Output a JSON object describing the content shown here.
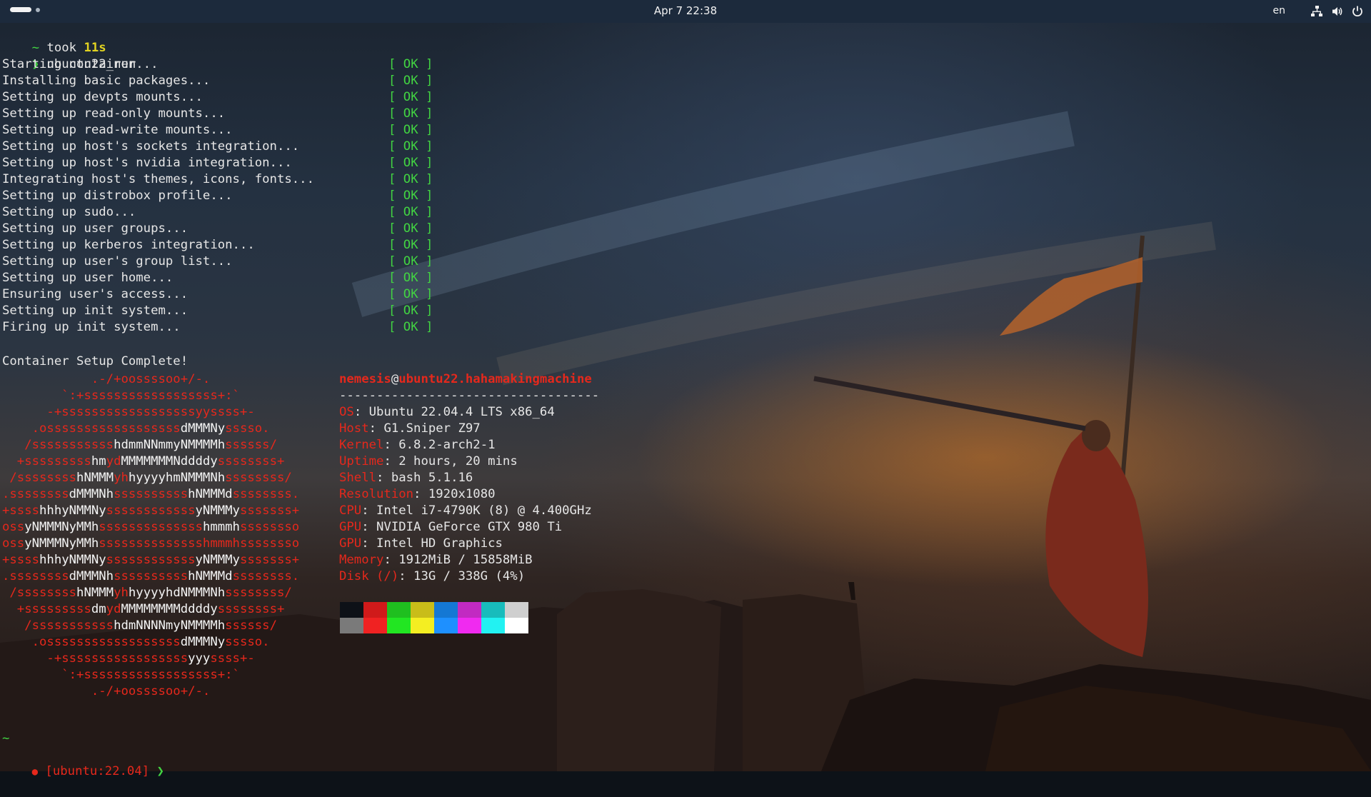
{
  "topbar": {
    "clock": "Apr 7  22:38",
    "language": "en"
  },
  "terminal": {
    "prev_prompt": {
      "tilde": "~",
      "took": "took",
      "duration": "11s"
    },
    "command": {
      "arrow": "❯",
      "text": "ubuntu22_run"
    },
    "setup_steps": [
      "Starting container...",
      "Installing basic packages...",
      "Setting up devpts mounts...",
      "Setting up read-only mounts...",
      "Setting up read-write mounts...",
      "Setting up host's sockets integration...",
      "Setting up host's nvidia integration...",
      "Integrating host's themes, icons, fonts...",
      "Setting up distrobox profile...",
      "Setting up sudo...",
      "Setting up user groups...",
      "Setting up kerberos integration...",
      "Setting up user's group list...",
      "Setting up user home...",
      "Ensuring user's access...",
      "Setting up init system...",
      "Firing up init system..."
    ],
    "ok_label": "[ OK ]",
    "complete_message": "Container Setup Complete!",
    "logo_lines": [
      [
        [
          "r",
          "            .-/+oossssoo+/-."
        ]
      ],
      [
        [
          "r",
          "        `:+ssssssssssssssssss+:`"
        ]
      ],
      [
        [
          "r",
          "      -+ssssssssssssssssssyyssss+-"
        ]
      ],
      [
        [
          "r",
          "    .ossssssssssssssssss"
        ],
        [
          "w",
          "dMMMNy"
        ],
        [
          "r",
          "sssso."
        ]
      ],
      [
        [
          "r",
          "   /sssssssssss"
        ],
        [
          "w",
          "hdmmNNmmyNMMMMh"
        ],
        [
          "r",
          "ssssss/"
        ]
      ],
      [
        [
          "r",
          "  +sssssssss"
        ],
        [
          "w",
          "hm"
        ],
        [
          "r",
          "yd"
        ],
        [
          "w",
          "MMMMMMMNddddy"
        ],
        [
          "r",
          "ssssssss+"
        ]
      ],
      [
        [
          "r",
          " /ssssssss"
        ],
        [
          "w",
          "hNMMM"
        ],
        [
          "r",
          "yh"
        ],
        [
          "w",
          "hyyyyhmNMMMNh"
        ],
        [
          "r",
          "ssssssss/"
        ]
      ],
      [
        [
          "r",
          ".ssssssss"
        ],
        [
          "w",
          "dMMMNh"
        ],
        [
          "r",
          "ssssssssss"
        ],
        [
          "w",
          "hNMMMd"
        ],
        [
          "r",
          "ssssssss."
        ]
      ],
      [
        [
          "r",
          "+ssss"
        ],
        [
          "w",
          "hhhyNMMNy"
        ],
        [
          "r",
          "ssssssssssss"
        ],
        [
          "w",
          "yNMMMy"
        ],
        [
          "r",
          "sssssss+"
        ]
      ],
      [
        [
          "r",
          "oss"
        ],
        [
          "w",
          "yNMMMNyMMh"
        ],
        [
          "r",
          "ssssssssssssss"
        ],
        [
          "w",
          "hmmmh"
        ],
        [
          "r",
          "ssssssso"
        ]
      ],
      [
        [
          "r",
          "oss"
        ],
        [
          "w",
          "yNMMMNyMMh"
        ],
        [
          "r",
          "sssssssssssssshmmmhssssssso"
        ]
      ],
      [
        [
          "r",
          "+ssss"
        ],
        [
          "w",
          "hhhyNMMNy"
        ],
        [
          "r",
          "ssssssssssss"
        ],
        [
          "w",
          "yNMMMy"
        ],
        [
          "r",
          "sssssss+"
        ]
      ],
      [
        [
          "r",
          ".ssssssss"
        ],
        [
          "w",
          "dMMMNh"
        ],
        [
          "r",
          "ssssssssss"
        ],
        [
          "w",
          "hNMMMd"
        ],
        [
          "r",
          "ssssssss."
        ]
      ],
      [
        [
          "r",
          " /ssssssss"
        ],
        [
          "w",
          "hNMMM"
        ],
        [
          "r",
          "yh"
        ],
        [
          "w",
          "hyyyyhdNMMMNh"
        ],
        [
          "r",
          "ssssssss/"
        ]
      ],
      [
        [
          "r",
          "  +sssssssss"
        ],
        [
          "w",
          "dm"
        ],
        [
          "r",
          "yd"
        ],
        [
          "w",
          "MMMMMMMMddddy"
        ],
        [
          "r",
          "ssssssss+"
        ]
      ],
      [
        [
          "r",
          "   /sssssssssss"
        ],
        [
          "w",
          "hdmNNNNmyNMMMMh"
        ],
        [
          "r",
          "ssssss/"
        ]
      ],
      [
        [
          "r",
          "    .ossssssssssssssssss"
        ],
        [
          "w",
          "dMMMNy"
        ],
        [
          "r",
          "sssso."
        ]
      ],
      [
        [
          "r",
          "      -+sssssssssssssssss"
        ],
        [
          "w",
          "yyy"
        ],
        [
          "r",
          "ssss+-"
        ]
      ],
      [
        [
          "r",
          "        `:+ssssssssssssssssss+:`"
        ]
      ],
      [
        [
          "r",
          "            .-/+oossssoo+/-."
        ]
      ]
    ],
    "sysinfo": {
      "user": "nemesis",
      "at": "@",
      "host": "ubuntu22.hahamakingmachine",
      "separator": "-----------------------------------",
      "rows": [
        {
          "key": "OS",
          "value": "Ubuntu 22.04.4 LTS x86_64"
        },
        {
          "key": "Host",
          "value": "G1.Sniper Z97"
        },
        {
          "key": "Kernel",
          "value": "6.8.2-arch2-1"
        },
        {
          "key": "Uptime",
          "value": "2 hours, 20 mins"
        },
        {
          "key": "Shell",
          "value": "bash 5.1.16"
        },
        {
          "key": "Resolution",
          "value": "1920x1080"
        },
        {
          "key": "CPU",
          "value": "Intel i7-4790K (8) @ 4.400GHz"
        },
        {
          "key": "GPU",
          "value": "NVIDIA GeForce GTX 980 Ti"
        },
        {
          "key": "GPU",
          "value": "Intel HD Graphics"
        },
        {
          "key": "Memory",
          "value": "1912MiB / 15858MiB"
        },
        {
          "key": "Disk (/)",
          "value": "13G / 338G (4%)"
        }
      ]
    },
    "palette": {
      "normal": [
        "#0d1117",
        "#d01a1a",
        "#1fbf1f",
        "#c9bd19",
        "#1478d4",
        "#c22ac2",
        "#18bcbc",
        "#cfcfcf"
      ],
      "bright": [
        "#7a7a7a",
        "#f02222",
        "#22e622",
        "#f4ee22",
        "#1e90ff",
        "#f02af0",
        "#22f2f2",
        "#ffffff"
      ]
    },
    "final_prompt": {
      "tilde": "~",
      "bullet": "●",
      "container": "[ubuntu:22.04]",
      "arrow": "❯"
    }
  }
}
